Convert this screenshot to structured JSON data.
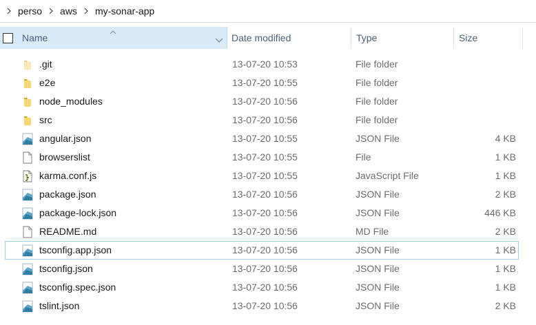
{
  "breadcrumb": [
    "perso",
    "aws",
    "my-sonar-app"
  ],
  "columns": {
    "name": "Name",
    "date": "Date modified",
    "type": "Type",
    "size": "Size"
  },
  "files": [
    {
      "name": ".git",
      "date": "13-07-20 10:53",
      "type": "File folder",
      "size": "",
      "icon": "folder-icon",
      "faded": true
    },
    {
      "name": "e2e",
      "date": "13-07-20 10:55",
      "type": "File folder",
      "size": "",
      "icon": "folder-icon"
    },
    {
      "name": "node_modules",
      "date": "13-07-20 10:56",
      "type": "File folder",
      "size": "",
      "icon": "folder-icon"
    },
    {
      "name": "src",
      "date": "13-07-20 10:56",
      "type": "File folder",
      "size": "",
      "icon": "folder-icon"
    },
    {
      "name": "angular.json",
      "date": "13-07-20 10:55",
      "type": "JSON File",
      "size": "4 KB",
      "icon": "json-file-icon"
    },
    {
      "name": "browserslist",
      "date": "13-07-20 10:55",
      "type": "File",
      "size": "1 KB",
      "icon": "blank-file-icon"
    },
    {
      "name": "karma.conf.js",
      "date": "13-07-20 10:55",
      "type": "JavaScript File",
      "size": "1 KB",
      "icon": "script-file-icon"
    },
    {
      "name": "package.json",
      "date": "13-07-20 10:56",
      "type": "JSON File",
      "size": "2 KB",
      "icon": "json-file-icon"
    },
    {
      "name": "package-lock.json",
      "date": "13-07-20 10:56",
      "type": "JSON File",
      "size": "446 KB",
      "icon": "json-file-icon"
    },
    {
      "name": "README.md",
      "date": "13-07-20 10:56",
      "type": "MD File",
      "size": "2 KB",
      "icon": "blank-file-icon"
    },
    {
      "name": "tsconfig.app.json",
      "date": "13-07-20 10:56",
      "type": "JSON File",
      "size": "1 KB",
      "icon": "json-file-icon",
      "selected": true
    },
    {
      "name": "tsconfig.json",
      "date": "13-07-20 10:56",
      "type": "JSON File",
      "size": "1 KB",
      "icon": "json-file-icon"
    },
    {
      "name": "tsconfig.spec.json",
      "date": "13-07-20 10:56",
      "type": "JSON File",
      "size": "1 KB",
      "icon": "json-file-icon"
    },
    {
      "name": "tslint.json",
      "date": "13-07-20 10:56",
      "type": "JSON File",
      "size": "2 KB",
      "icon": "json-file-icon"
    }
  ]
}
